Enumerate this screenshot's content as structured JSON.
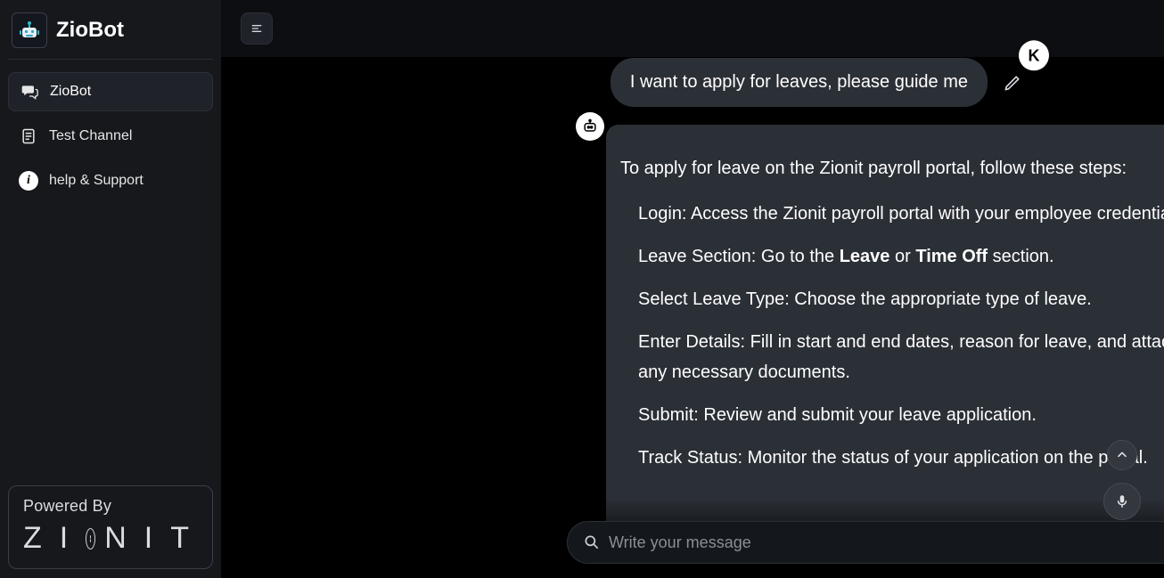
{
  "brand": {
    "name": "ZioBot"
  },
  "sidebar": {
    "items": [
      {
        "label": "ZioBot"
      },
      {
        "label": "Test Channel"
      },
      {
        "label": "help & Support"
      }
    ]
  },
  "powered": {
    "label": "Powered By",
    "company": "ZIONIT"
  },
  "user": {
    "avatar_initial": "K"
  },
  "chat": {
    "user_message": "I want to apply for leaves, please guide me",
    "bot_heading": "To apply for leave on the Zionit payroll portal, follow these steps:",
    "steps": [
      {
        "lead": "Login:",
        "rest": " Access the Zionit payroll portal with your employee credentials."
      },
      {
        "lead": "Leave Section:",
        "rest_pre": " Go to the ",
        "bold1": "Leave",
        "mid": " or ",
        "bold2": "Time Off",
        "rest_post": " section."
      },
      {
        "lead": "Select Leave Type:",
        "rest": " Choose the appropriate type of leave."
      },
      {
        "lead": "Enter Details:",
        "rest": " Fill in start and end dates, reason for leave, and attach any necessary documents."
      },
      {
        "lead": "Submit:",
        "rest": " Review and submit your leave application."
      },
      {
        "lead": "Track Status:",
        "rest": " Monitor the status of your application on the portal."
      }
    ]
  },
  "composer": {
    "placeholder": "Write your message"
  }
}
